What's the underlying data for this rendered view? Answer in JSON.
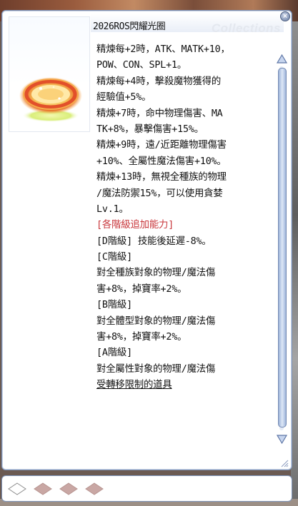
{
  "item": {
    "name": "2026ROS閃耀光圈",
    "watermark": "Collections",
    "close_symbol": "×",
    "description_lines": [
      {
        "text": "精煉每+2時，ATK、MATK+10，",
        "style": ""
      },
      {
        "text": "POW、CON、SPL+1。",
        "style": ""
      },
      {
        "text": "精煉每+4時，擊殺魔物獲得的",
        "style": ""
      },
      {
        "text": "經驗值+5%。",
        "style": ""
      },
      {
        "text": "精煉+7時，命中物理傷害、MA",
        "style": ""
      },
      {
        "text": "TK+8%，暴擊傷害+15%。",
        "style": ""
      },
      {
        "text": "精煉+9時，遠/近距離物理傷害",
        "style": ""
      },
      {
        "text": "+10%、全屬性魔法傷害+10%。",
        "style": ""
      },
      {
        "text": "精煉+13時，無視全種族的物理",
        "style": ""
      },
      {
        "text": "/魔法防禦15%，可以使用貪婪",
        "style": ""
      },
      {
        "text": "Lv.1。",
        "style": ""
      },
      {
        "text": "[各階級追加能力]",
        "style": "red"
      },
      {
        "text": "[D階級] 技能後延遲-8%。",
        "style": ""
      },
      {
        "text": "[C階級]",
        "style": ""
      },
      {
        "text": " 對全種族對象的物理/魔法傷",
        "style": ""
      },
      {
        "text": "害+8%，掉寶率+2%。",
        "style": ""
      },
      {
        "text": "[B階級]",
        "style": ""
      },
      {
        "text": " 對全體型對象的物理/魔法傷",
        "style": ""
      },
      {
        "text": "害+8%，掉寶率+2%。",
        "style": ""
      },
      {
        "text": "[A階級]",
        "style": ""
      },
      {
        "text": " 對全屬性對象的物理/魔法傷",
        "style": ""
      },
      {
        "text": "受轉移限制的道具",
        "style": "ul"
      }
    ]
  },
  "slots": [
    {
      "state": "empty"
    },
    {
      "state": "unavailable"
    },
    {
      "state": "unavailable"
    },
    {
      "state": "unavailable"
    }
  ],
  "colors": {
    "accent_red": "#c8353a",
    "window_border": "#7d93b8",
    "scroll_blue": "#9fb5da",
    "slot_fill": "#c9a7a4"
  },
  "icons": {
    "item": "halo-ring-icon",
    "close": "close-icon",
    "scroll_up": "arrow-up-icon",
    "scroll_down": "arrow-down-icon",
    "slot": "card-slot-icon"
  }
}
